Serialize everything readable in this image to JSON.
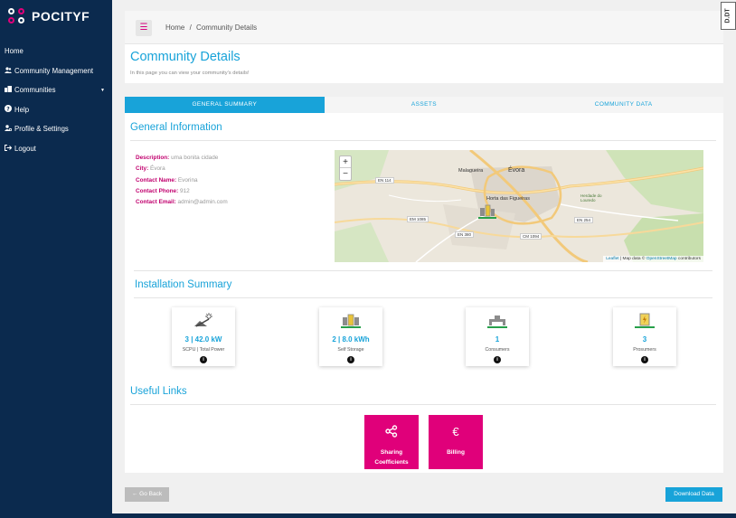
{
  "app": {
    "name": "POCITYF"
  },
  "sidebar": {
    "items": [
      {
        "label": "Home",
        "icon": ""
      },
      {
        "label": "Community Management",
        "icon": "users-icon"
      },
      {
        "label": "Communities",
        "icon": "buildings-icon",
        "has_dropdown": true
      },
      {
        "label": "Help",
        "icon": "question-icon"
      },
      {
        "label": "Profile & Settings",
        "icon": "user-gear-icon"
      },
      {
        "label": "Logout",
        "icon": "logout-icon"
      }
    ]
  },
  "header": {
    "breadcrumb_home": "Home",
    "breadcrumb_separator": "/",
    "breadcrumb_current": "Community Details",
    "corner_badge": "D.DT"
  },
  "page": {
    "title": "Community Details",
    "subtitle": "In this page you can view your community's details!"
  },
  "tabs": [
    {
      "label": "GENERAL SUMMARY",
      "active": true
    },
    {
      "label": "ASSETS",
      "active": false
    },
    {
      "label": "COMMUNITY DATA",
      "active": false
    }
  ],
  "general_information": {
    "title": "General Information",
    "fields": [
      {
        "key": "Description:",
        "value": "uma bonita cidade"
      },
      {
        "key": "City:",
        "value": "Évora"
      },
      {
        "key": "Contact Name:",
        "value": "Evorina"
      },
      {
        "key": "Contact Phone:",
        "value": "912"
      },
      {
        "key": "Contact Email:",
        "value": "admin@admin.com"
      }
    ]
  },
  "map": {
    "zoom_in": "+",
    "zoom_out": "−",
    "labels": {
      "malagueira": "Malagueira",
      "evora": "Évora",
      "horta": "Horta das Figueiras",
      "herdade": "Herdade do Louredo"
    },
    "roads": {
      "en114": "EN 114",
      "em1085": "EM 1085",
      "en380": "EN 380",
      "cm1094": "CM 1094",
      "en254": "EN 254"
    },
    "attribution": {
      "leaflet": "Leaflet",
      "separator": " | Map data © ",
      "osm": "OpenStreetMap",
      "contributors": " contributors"
    }
  },
  "installation_summary": {
    "title": "Installation Summary",
    "cards": [
      {
        "value": "3 | 42.0 kW",
        "label": "SCPU | Total Power",
        "icon": "solar-panel-icon"
      },
      {
        "value": "2 | 8.0 kWh",
        "label": "Self Storage",
        "icon": "battery-storage-icon"
      },
      {
        "value": "1",
        "label": "Consumers",
        "icon": "consumer-icon"
      },
      {
        "value": "3",
        "label": "Prosumers",
        "icon": "prosumer-icon"
      }
    ],
    "info_symbol": "i"
  },
  "useful_links": {
    "title": "Useful Links",
    "tiles": [
      {
        "label_line1": "Sharing",
        "label_line2": "Coefficients",
        "icon": "share-icon"
      },
      {
        "label_line1": "Billing",
        "label_line2": "",
        "icon": "euro-icon"
      }
    ]
  },
  "actions": {
    "go_back": "← Go Back",
    "download": "Download Data"
  },
  "colors": {
    "sidebar": "#0b2a4e",
    "accent_blue": "#18a3d9",
    "accent_pink": "#e0007a",
    "label_magenta": "#c1006e"
  }
}
